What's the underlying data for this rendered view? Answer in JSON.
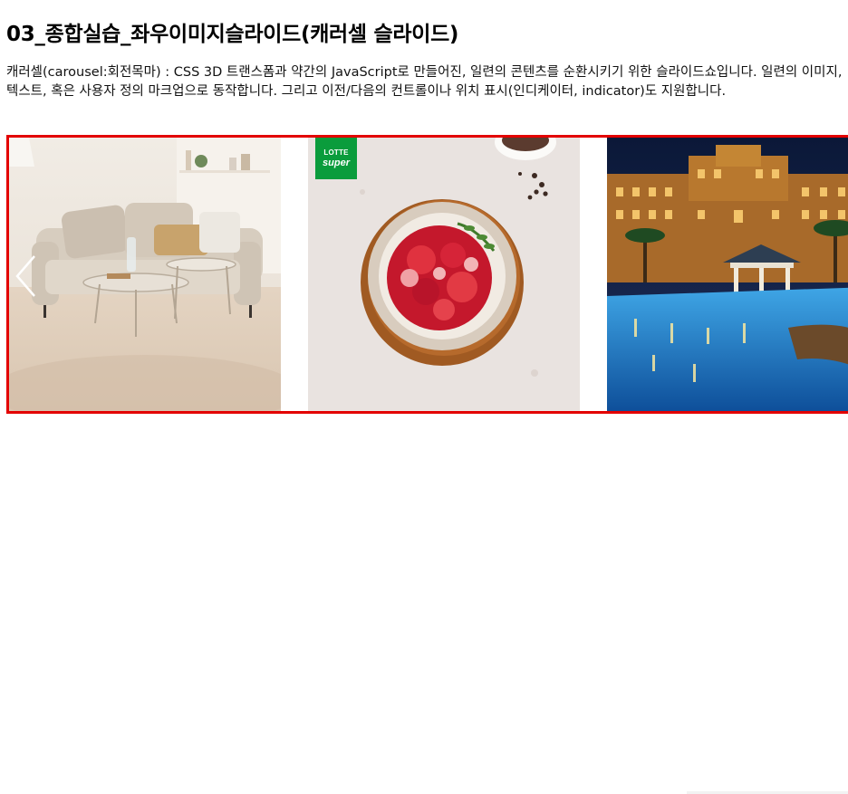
{
  "page": {
    "title": "03_종합실습_좌우이미지슬라이드(캐러셀 슬라이드)",
    "description": "캐러셀(carousel:회전목마) : CSS 3D 트랜스폼과 약간의 JavaScript로 만들어진, 일련의 콘텐츠를 순환시키기 위한 슬라이드쇼입니다. 일련의 이미지, 텍스트, 혹은 사용자 정의 마크업으로 동작합니다. 그리고 이전/다음의 컨트롤이나 위치 표시(인디케이터, indicator)도 지원합니다."
  },
  "carousel": {
    "border_color": "#e30000",
    "prev_icon": "chevron-left-icon",
    "slides": [
      {
        "subject": "living-room-sofa-image"
      },
      {
        "subject": "beef-plate-image",
        "brand_line1": "LOTTE",
        "brand_line2": "super",
        "brand_color": "#0a9c3c"
      },
      {
        "subject": "resort-pool-night-image"
      }
    ]
  }
}
